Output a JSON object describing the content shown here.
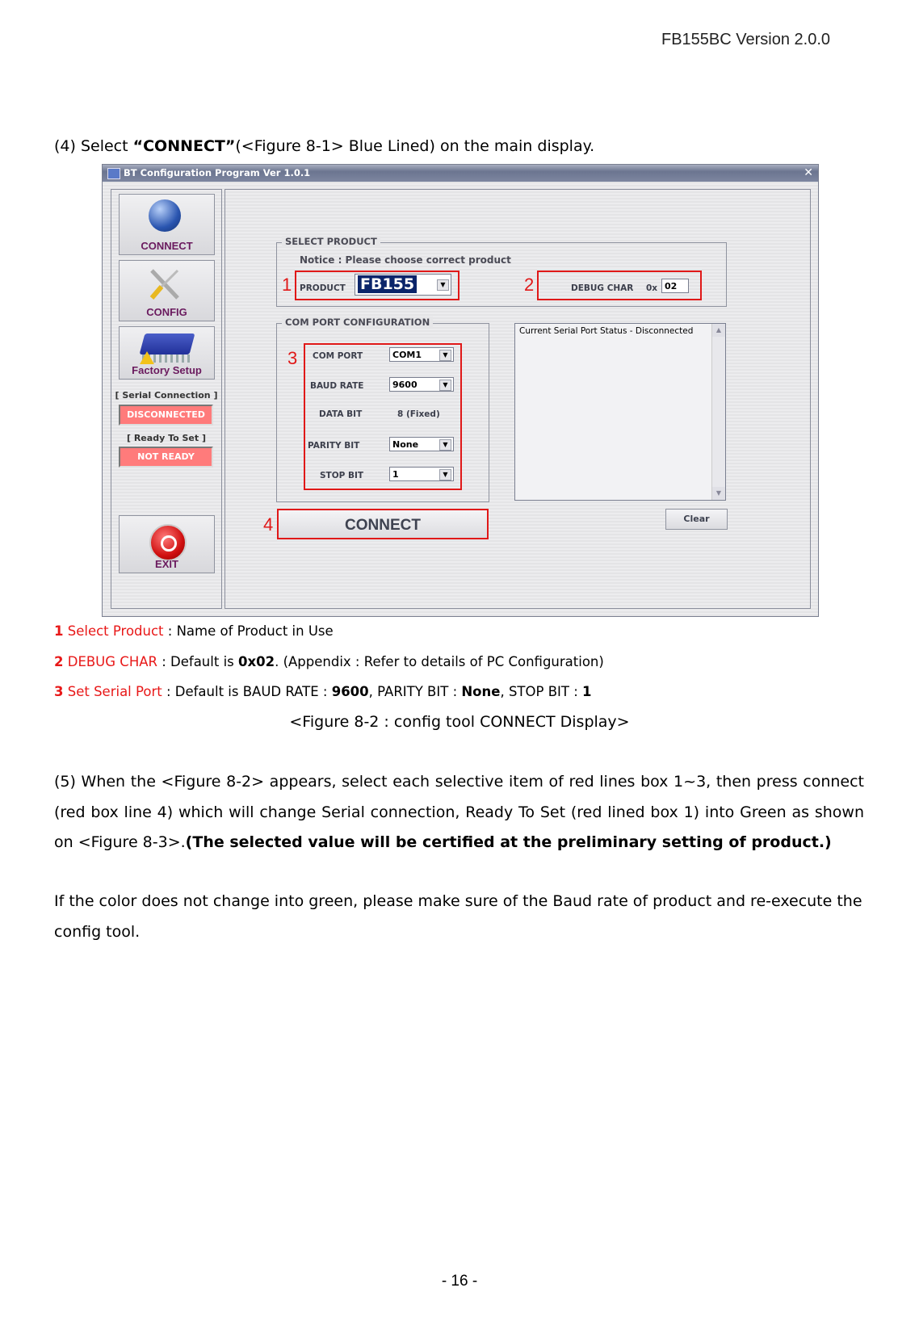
{
  "header": {
    "doc_version": "FB155BC Version 2.0.0"
  },
  "step4": {
    "prefix": "(4)   Select ",
    "bold": "“CONNECT”",
    "suffix": "(<Figure 8-1> Blue Lined) on the main display."
  },
  "app": {
    "title": "BT Configuration Program Ver 1.0.1",
    "close_icon": "close-icon",
    "left_buttons": [
      {
        "label": "CONNECT",
        "icon": "globe-cable-icon"
      },
      {
        "label": "CONFIG",
        "icon": "wrench-screwdriver-icon"
      },
      {
        "label": "Factory Setup",
        "icon": "chip-warning-icon"
      }
    ],
    "serial_connection": {
      "label": "[ Serial Connection ]",
      "status": "DISCONNECTED",
      "color": "#ff7b7b"
    },
    "ready_to_set": {
      "label": "[   Ready To Set   ]",
      "status": "NOT READY",
      "color": "#ff7b7b"
    },
    "exit_button": {
      "label": "EXIT",
      "icon": "power-icon"
    },
    "select_product": {
      "group_title": "SELECT PRODUCT",
      "notice": "Notice : Please choose correct product",
      "product_label": "PRODUCT",
      "product_value": "FB155",
      "debug_char_label": "DEBUG CHAR",
      "debug_prefix": "0x",
      "debug_value": "02"
    },
    "com_port_config": {
      "group_title": "COM PORT CONFIGURATION",
      "fields": [
        {
          "label": "COM PORT",
          "value": "COM1",
          "type": "select"
        },
        {
          "label": "BAUD RATE",
          "value": "9600",
          "type": "select"
        },
        {
          "label": "DATA BIT",
          "value": "8 (Fixed)",
          "type": "static"
        },
        {
          "label": "PARITY BIT",
          "value": "None",
          "type": "select"
        },
        {
          "label": "STOP BIT",
          "value": "1",
          "type": "select"
        }
      ]
    },
    "log_text": "Current Serial Port Status - Disconnected",
    "connect_label": "CONNECT",
    "clear_label": "Clear",
    "annotations": [
      "1",
      "2",
      "3",
      "4"
    ],
    "annotation_color": "#e01818"
  },
  "notes": [
    {
      "num": "1",
      "title": "Select Product",
      "text": " : Name of Product in Use"
    },
    {
      "num": "2",
      "title": "DEBUG CHAR",
      "text_before": " : Default is ",
      "bold": "0x02",
      "text_after": ". (Appendix : Refer to details of PC Configuration)"
    },
    {
      "num": "3",
      "title": "Set Serial Port",
      "t1": " : Default is BAUD RATE : ",
      "b1": "9600",
      "t2": ", PARITY BIT : ",
      "b2": "None",
      "t3": ", STOP BIT : ",
      "b3": "1"
    }
  ],
  "caption": "<Figure 8-2 : config tool CONNECT Display>",
  "step5": {
    "text": "(5) When the <Figure 8-2> appears, select each selective item of red lines box 1~3, then press connect (red box line 4) which will change Serial connection, Ready To Set (red lined box 1) into Green as shown on  <Figure 8-3>.",
    "bold": "(The selected value will be certified at the preliminary setting of product.)",
    "followup": "If the color does not change into green, please make sure of the Baud rate of product and re-execute the config tool."
  },
  "page_number": "- 16 -"
}
